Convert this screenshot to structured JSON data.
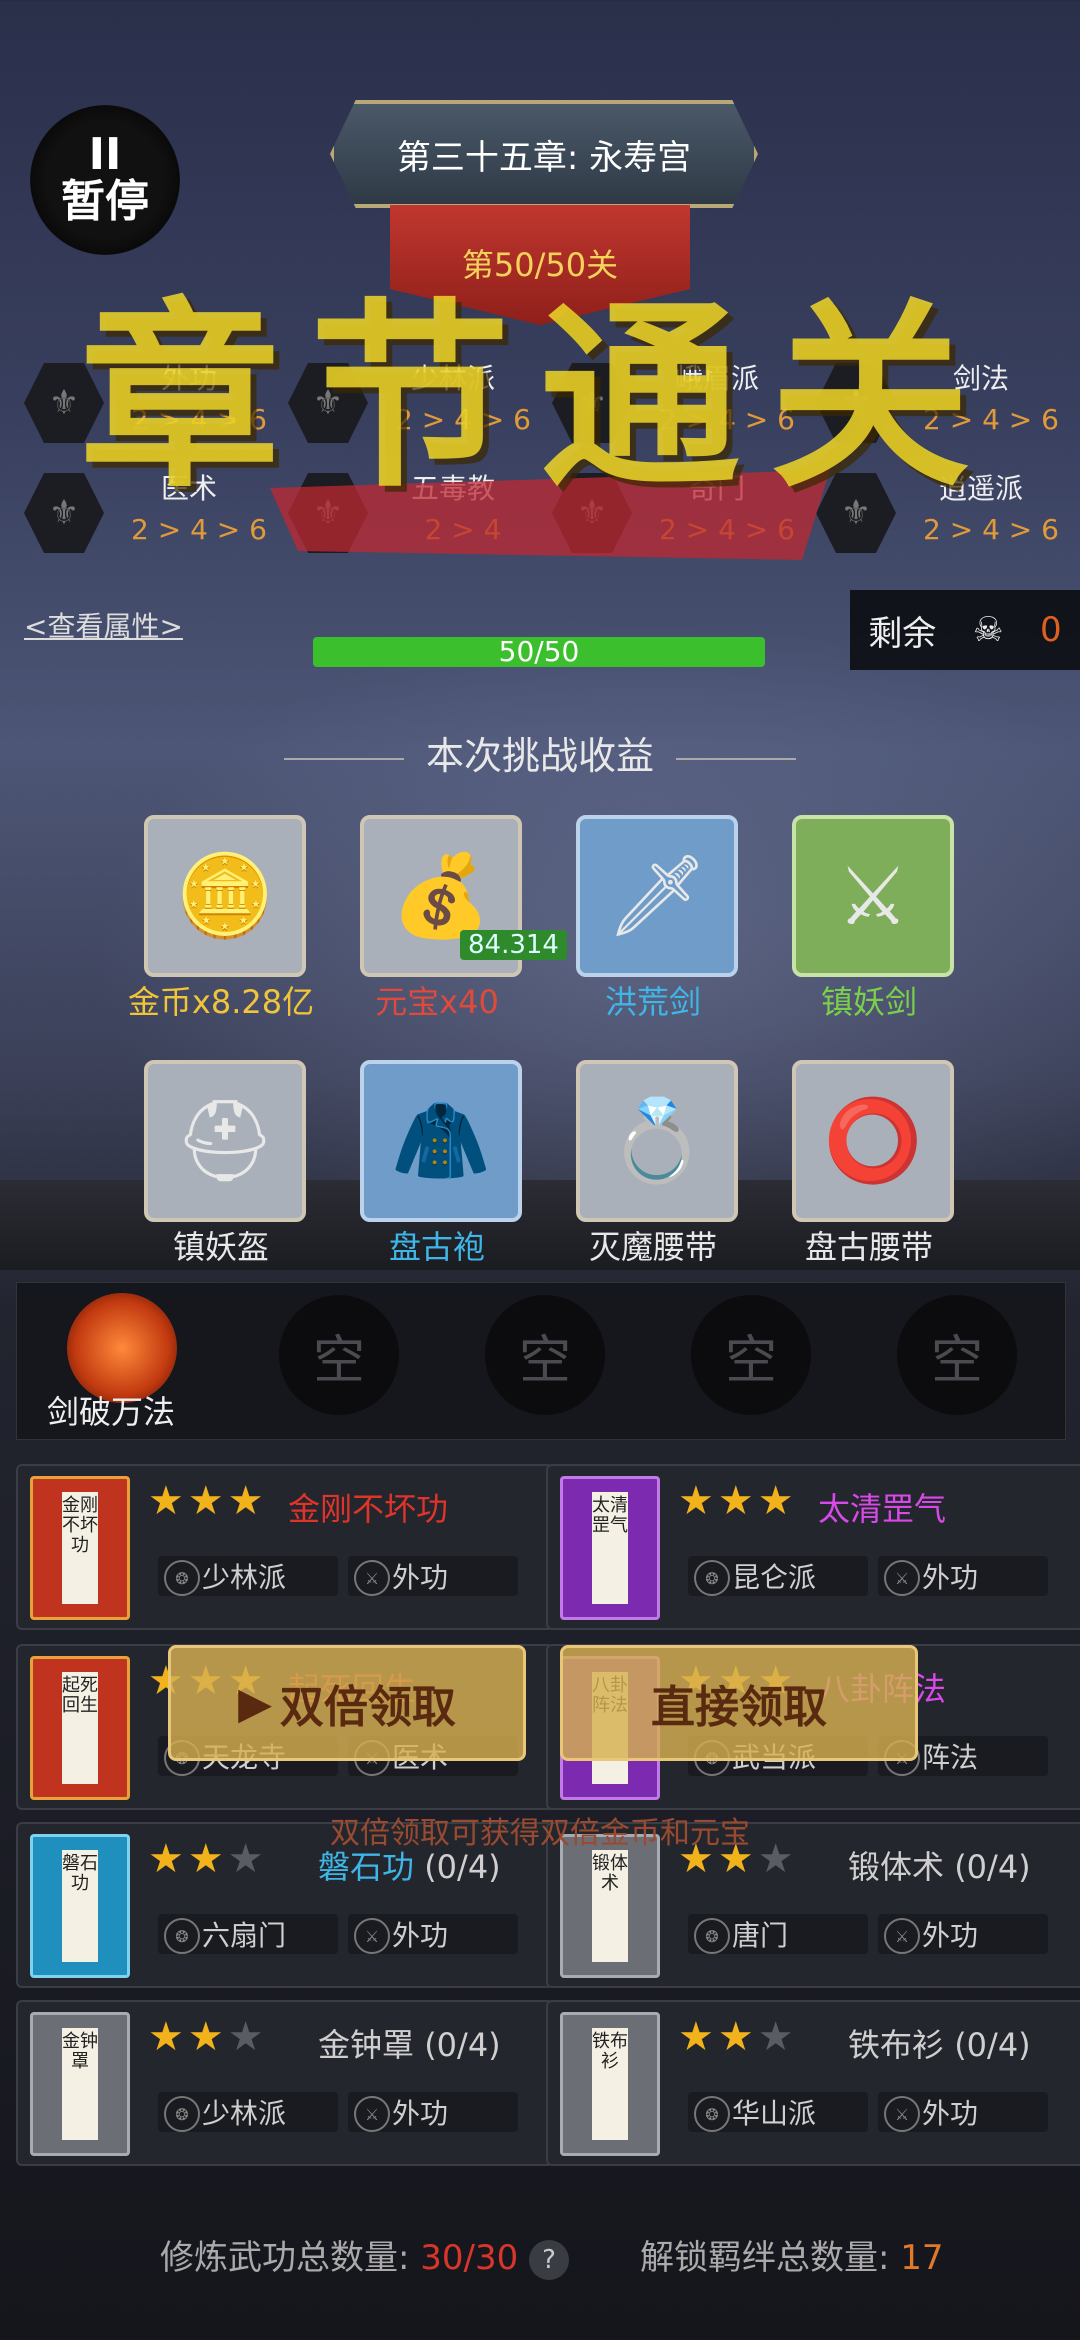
{
  "pause": {
    "icon": "II",
    "label": "暂停"
  },
  "chapter": {
    "title": "第三十五章: 永寿宫",
    "stage": "第50/50关"
  },
  "skills": [
    {
      "name": "外功",
      "levels": "2 > 4 > 6"
    },
    {
      "name": "少林派",
      "levels": "2 > 4 > 6"
    },
    {
      "name": "峨眉派",
      "levels": "2 > 4 > 6"
    },
    {
      "name": "剑法",
      "levels": "2 > 4 > 6"
    },
    {
      "name": "医术",
      "levels": "2 > 4 > 6"
    },
    {
      "name": "五毒教",
      "levels": "2 > 4"
    },
    {
      "name": "奇门",
      "levels": "2 > 4 > 6"
    },
    {
      "name": "逍遥派",
      "levels": "2 > 4 > 6"
    }
  ],
  "overlay_title": "章节通关",
  "view_attributes": "<查看属性>",
  "progress": {
    "label": "50/50",
    "current": 50,
    "max": 50
  },
  "remaining": {
    "label": "剩余",
    "value": "0"
  },
  "gain_header": "本次挑战收益",
  "float_number": "84.314",
  "rewards": [
    {
      "label": "金币x8.28亿",
      "color": "#f0c53a",
      "icon": "coins-icon",
      "glyph": "🪙",
      "style": ""
    },
    {
      "label": "元宝x40",
      "color": "#e04a3a",
      "icon": "gold-ingot-icon",
      "glyph": "💰",
      "style": ""
    },
    {
      "label": "洪荒剑",
      "color": "#3fb6e8",
      "icon": "sword-icon",
      "glyph": "🗡",
      "style": "blue"
    },
    {
      "label": "镇妖剑",
      "color": "#7ad04a",
      "icon": "golden-sword-icon",
      "glyph": "⚔",
      "style": "green"
    },
    {
      "label": "镇妖盔",
      "color": "#e8e8e8",
      "icon": "helmet-icon",
      "glyph": "⛑",
      "style": ""
    },
    {
      "label": "盘古袍",
      "color": "#3fb6e8",
      "icon": "armor-icon",
      "glyph": "🧥",
      "style": "blue"
    },
    {
      "label": "灭魔腰带",
      "color": "#e8e8e8",
      "icon": "belt-icon",
      "glyph": "💍",
      "style": ""
    },
    {
      "label": "盘古腰带",
      "color": "#e8e8e8",
      "icon": "belt-icon",
      "glyph": "⭕",
      "style": ""
    }
  ],
  "first_slot_label": "剑破万法",
  "empty_slot": "空",
  "techniques": [
    {
      "book": "金刚不坏功",
      "book_style": "red",
      "stars": 3,
      "name": "金刚不坏功",
      "name_color": "#e0342a",
      "tags": [
        "少林派",
        "外功"
      ]
    },
    {
      "book": "太清罡气",
      "book_style": "purple",
      "stars": 3,
      "name": "太清罡气",
      "name_color": "#d84ae8",
      "tags": [
        "昆仑派",
        "外功"
      ]
    },
    {
      "book": "起死回生",
      "book_style": "red",
      "stars": 3,
      "name": "起死回生",
      "name_color": "#e0342a",
      "tags": [
        "天龙寺",
        "医术"
      ]
    },
    {
      "book": "八卦阵法",
      "book_style": "purple",
      "stars": 3,
      "name": "八卦阵法",
      "name_color": "#d84ae8",
      "tags": [
        "武当派",
        "阵法"
      ]
    },
    {
      "book": "磐石功",
      "book_style": "blue",
      "stars": 2,
      "name": "磐石功",
      "progress": "(0/4)",
      "name_color": "#3fb6e8",
      "tags": [
        "六扇门",
        "外功"
      ]
    },
    {
      "book": "锻体术",
      "book_style": "gray",
      "stars": 2,
      "name": "锻体术",
      "progress": "(0/4)",
      "name_color": "#cfcfcf",
      "tags": [
        "唐门",
        "外功"
      ]
    },
    {
      "book": "金钟罩",
      "book_style": "gray",
      "stars": 2,
      "name": "金钟罩",
      "progress": "(0/4)",
      "name_color": "#cfcfcf",
      "tags": [
        "少林派",
        "外功"
      ]
    },
    {
      "book": "铁布衫",
      "book_style": "gray",
      "stars": 2,
      "name": "铁布衫",
      "progress": "(0/4)",
      "name_color": "#cfcfcf",
      "tags": [
        "华山派",
        "外功"
      ]
    }
  ],
  "buttons": {
    "double": "双倍领取",
    "direct": "直接领取"
  },
  "hint": "双倍领取可获得双倍金币和元宝",
  "footer": {
    "train_label": "修炼武功总数量:",
    "train_value": "30/30",
    "bond_label": "解锁羁绊总数量:",
    "bond_value": "17",
    "help": "?"
  }
}
